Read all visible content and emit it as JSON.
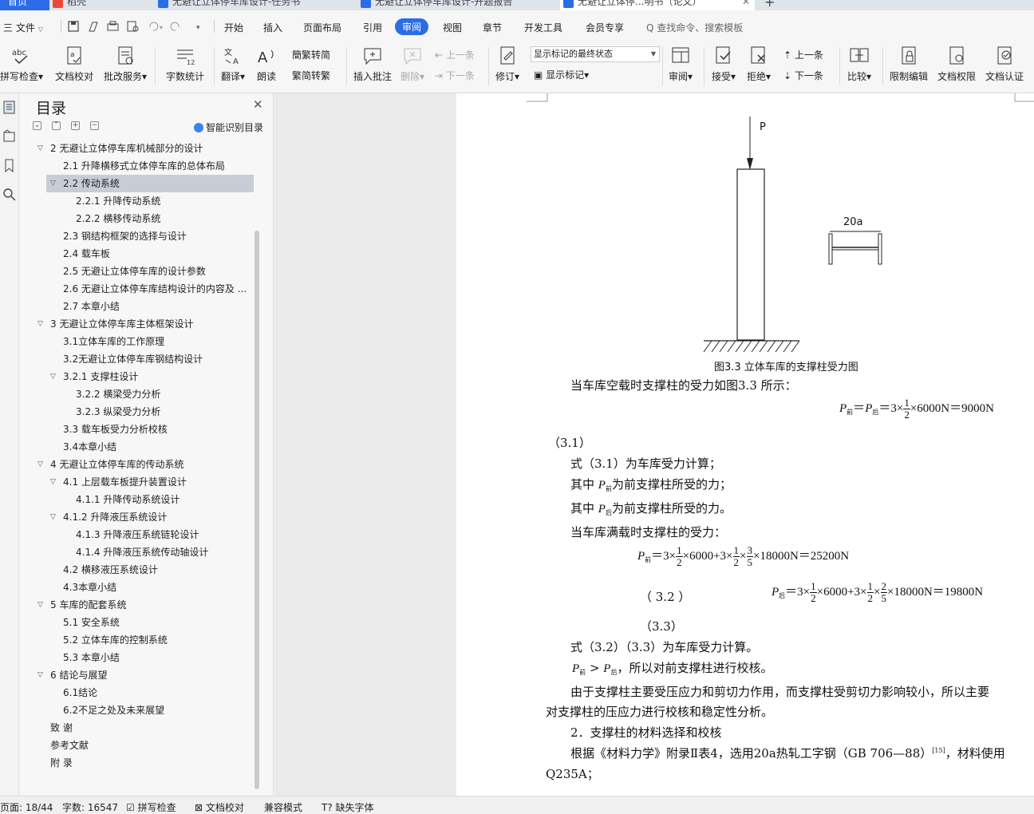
{
  "tabs": [
    {
      "label": "首页"
    },
    {
      "label": "稻壳"
    },
    {
      "label": "无避让立体停车库设计-任务书"
    },
    {
      "label": "无避让立体停车库设计-开题报告"
    },
    {
      "label": "无避让立体停...明书（论文）"
    }
  ],
  "menu": {
    "file": "三 文件",
    "items": [
      "开始",
      "插入",
      "页面布局",
      "引用",
      "审阅",
      "视图",
      "章节",
      "开发工具",
      "会员专享"
    ],
    "active": "审阅",
    "search_placeholder": "Q 查找命令、搜索模板"
  },
  "ribbon": {
    "spell": "拼写检查",
    "doc_check": "文档校对",
    "batch": "批改服务",
    "word_count": "字数统计",
    "translate": "翻译",
    "read": "朗读",
    "trad": "繁转简",
    "simp": "简转繁",
    "insert_comment": "插入批注",
    "delete": "删除",
    "prev_c": "上一条",
    "next_c": "下一条",
    "revise": "修订",
    "markup_state": "显示标记的最终状态",
    "show_markup": "显示标记",
    "review": "审阅",
    "accept": "接受",
    "reject": "拒绝",
    "prev": "上一条",
    "next": "下一条",
    "compare": "比较",
    "restrict": "限制编辑",
    "perm": "文档权限",
    "cert": "文档认证"
  },
  "toc": {
    "title": "目录",
    "smart": "智能识别目录",
    "items": [
      {
        "text": "2  无避让立体停车库机械部分的设计",
        "level": 1,
        "toggle": "open"
      },
      {
        "text": "2.1  升降横移式立体停车库的总体布局",
        "level": 2,
        "toggle": ""
      },
      {
        "text": "2.2  传动系统",
        "level": 2,
        "toggle": "open",
        "selected": true
      },
      {
        "text": "2.2.1 升降传动系统",
        "level": 3,
        "toggle": ""
      },
      {
        "text": "2.2.2 横移传动系统",
        "level": 3,
        "toggle": ""
      },
      {
        "text": "2.3  钢结构框架的选择与设计",
        "level": 2,
        "toggle": ""
      },
      {
        "text": "2.4  载车板",
        "level": 2,
        "toggle": ""
      },
      {
        "text": "2.5  无避让立体停车库的设计参数",
        "level": 2,
        "toggle": ""
      },
      {
        "text": "2.6  无避让立体停车库结构设计的内容及 ...",
        "level": 2,
        "toggle": ""
      },
      {
        "text": "2.7  本章小结",
        "level": 2,
        "toggle": ""
      },
      {
        "text": "3  无避让立体停车库主体框架设计",
        "level": 1,
        "toggle": "open"
      },
      {
        "text": "3.1立体车库的工作原理",
        "level": 2,
        "toggle": ""
      },
      {
        "text": "3.2无避让立体停车库钢结构设计",
        "level": 2,
        "toggle": ""
      },
      {
        "text": "3.2.1  支撑柱设计",
        "level": 2,
        "toggle": "open"
      },
      {
        "text": "3.2.2  横梁受力分析",
        "level": 3,
        "toggle": ""
      },
      {
        "text": "3.2.3  纵梁受力分析",
        "level": 3,
        "toggle": ""
      },
      {
        "text": "3.3  载车板受力分析校核",
        "level": 2,
        "toggle": ""
      },
      {
        "text": "3.4本章小结",
        "level": 2,
        "toggle": ""
      },
      {
        "text": "4  无避让立体停车库的传动系统",
        "level": 1,
        "toggle": "open"
      },
      {
        "text": "4.1  上层载车板提升装置设计",
        "level": 2,
        "toggle": "open"
      },
      {
        "text": "4.1.1  升降传动系统设计",
        "level": 3,
        "toggle": ""
      },
      {
        "text": "4.1.2  升降液压系统设计",
        "level": 2,
        "toggle": "open"
      },
      {
        "text": "4.1.3  升降液压系统链轮设计",
        "level": 3,
        "toggle": ""
      },
      {
        "text": "4.1.4  升降液压系统传动轴设计",
        "level": 3,
        "toggle": ""
      },
      {
        "text": "4.2  横移液压系统设计",
        "level": 2,
        "toggle": ""
      },
      {
        "text": "4.3本章小结",
        "level": 2,
        "toggle": ""
      },
      {
        "text": "5  车库的配套系统",
        "level": 1,
        "toggle": "open"
      },
      {
        "text": "5.1  安全系统",
        "level": 2,
        "toggle": ""
      },
      {
        "text": "5.2  立体车库的控制系统",
        "level": 2,
        "toggle": ""
      },
      {
        "text": "5.3  本章小结",
        "level": 2,
        "toggle": ""
      },
      {
        "text": "6  结论与展望",
        "level": 1,
        "toggle": "open"
      },
      {
        "text": "6.1结论",
        "level": 2,
        "toggle": ""
      },
      {
        "text": "6.2不足之处及未来展望",
        "level": 2,
        "toggle": ""
      },
      {
        "text": "致    谢",
        "level": 1,
        "toggle": ""
      },
      {
        "text": "参考文献",
        "level": 1,
        "toggle": ""
      },
      {
        "text": "附    录",
        "level": 1,
        "toggle": ""
      }
    ]
  },
  "doc": {
    "fig_p": "P",
    "fig_beam": "20a",
    "fig_caption": "图3.3  立体车库的支撑柱受力图",
    "l1": "当车库空载时支撑柱的受力如图3.3  所示：",
    "eq1": "×6000N＝9000N",
    "eq1_num": "（3.1）",
    "l2": "式（3.1）为车库受力计算；",
    "l3a": "其中",
    "l3b": "为前支撑柱所受的力；",
    "l4a": "其中",
    "l4b": "为前支撑柱所受的力。",
    "l5": "当车库满载时支撑柱的受力：",
    "eq2_tail": "×18000N＝25200N",
    "eq3_num": "（          3.2          ）",
    "eq3_tail": "×18000N＝19800N",
    "eq3_label": "（3.3）",
    "l6": "式（3.2）（3.3）为车库受力计算。",
    "l7": "，所以对前支撑柱进行校核。",
    "l8": "由于支撑柱主要受压应力和剪切力作用，而支撑柱受剪切力影响较小，所以主要",
    "l9": "对支撑柱的压应力进行校核和稳定性分析。",
    "l10": "2．支撑柱的材料选择和校核",
    "l11a": "根据《材料力学》附录Ⅱ表4，选用20a热轧工字钢（GB 706—88）",
    "l11ref": "[15]",
    "l11b": "，材料使用",
    "l12": "Q235A；"
  },
  "status": {
    "page": "页面: 18/44",
    "words": "字数: 16547",
    "spell": "拼写检查",
    "check": "文档校对",
    "compat": "兼容模式",
    "missing_font": "缺失字体"
  }
}
